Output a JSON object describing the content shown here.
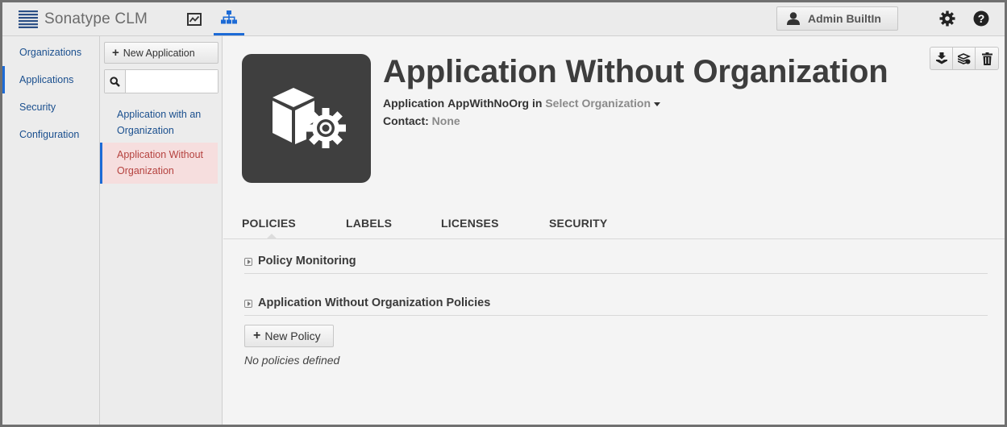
{
  "app": {
    "brand_name": "Sonatype CLM",
    "brand_icon": "stacked-lines-logo-icon"
  },
  "topnav": {
    "dashboard_icon": "chart-icon",
    "manage_icon": "hierarchy-icon",
    "user_label": "Admin BuiltIn",
    "user_icon": "user-icon",
    "settings_icon": "gear-icon",
    "help_icon": "help-icon"
  },
  "sidebar": {
    "items": [
      {
        "label": "Organizations"
      },
      {
        "label": "Applications"
      },
      {
        "label": "Security"
      },
      {
        "label": "Configuration"
      }
    ]
  },
  "applications": {
    "new_button_label": "New Application",
    "search_placeholder": "",
    "list": [
      {
        "name": "Application with an Organization"
      },
      {
        "name": "Application Without Organization"
      }
    ]
  },
  "detail": {
    "title": "Application Without Organization",
    "app_prefix": "Application",
    "app_id": "AppWithNoOrg",
    "in_word": "in",
    "org_select": "Select Organization",
    "contact_label": "Contact:",
    "contact_value": "None",
    "actions": [
      "download-icon",
      "stack-edit-icon",
      "trash-icon"
    ]
  },
  "tabs": [
    "POLICIES",
    "LABELS",
    "LICENSES",
    "SECURITY"
  ],
  "policies": {
    "monitoring_header": "Policy Monitoring",
    "policies_header": "Application Without Organization Policies",
    "new_policy_label": "New Policy",
    "empty_text": "No policies defined"
  },
  "colors": {
    "accent": "#1d6bd6",
    "link": "#1a4f8e",
    "selected_bg": "#f6dede",
    "selected_text": "#b5423f",
    "tile_bg": "#3f3f3f"
  }
}
